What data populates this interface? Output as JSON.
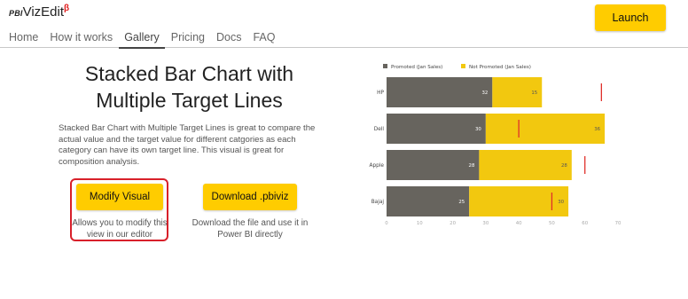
{
  "header": {
    "logo_prefix": "PBI",
    "logo_text": "VizEdit",
    "logo_badge": "β",
    "launch_label": "Launch"
  },
  "nav": {
    "items": [
      {
        "label": "Home"
      },
      {
        "label": "How it works"
      },
      {
        "label": "Gallery"
      },
      {
        "label": "Pricing"
      },
      {
        "label": "Docs"
      },
      {
        "label": "FAQ"
      }
    ],
    "active": "Gallery"
  },
  "main": {
    "title_line1": "Stacked Bar Chart with",
    "title_line2": "Multiple Target Lines",
    "description": "Stacked Bar Chart with Multiple Target Lines is great to compare the actual value and the target value for different catgories as each category can have its own target line. This visual is great for composition analysis.",
    "modify_label": "Modify Visual",
    "modify_caption": "Allows you to modify this view in our editor",
    "download_label": "Download .pbiviz",
    "download_caption": "Download the file and use it in Power BI directly"
  },
  "colors": {
    "accent": "#ffcc00",
    "highlight": "#d8202a",
    "promoted": "#67645e",
    "not_promoted": "#f2c80f",
    "target": "#e0302a"
  },
  "chart_data": {
    "type": "bar",
    "orientation": "horizontal",
    "stacked": true,
    "categories": [
      "HP",
      "Dell",
      "Apple",
      "Bajaj"
    ],
    "series": [
      {
        "name": "Promoted (Jan Sales)",
        "values": [
          32,
          30,
          28,
          25
        ]
      },
      {
        "name": "Not Promoted (Jan Sales)",
        "values": [
          15,
          36,
          28,
          30
        ]
      }
    ],
    "targets": [
      65,
      40,
      60,
      50
    ],
    "x_ticks": [
      0,
      10,
      20,
      30,
      40,
      50,
      60,
      70
    ],
    "xlim": [
      0,
      70
    ],
    "legend_position": "top-left",
    "grid": false
  }
}
